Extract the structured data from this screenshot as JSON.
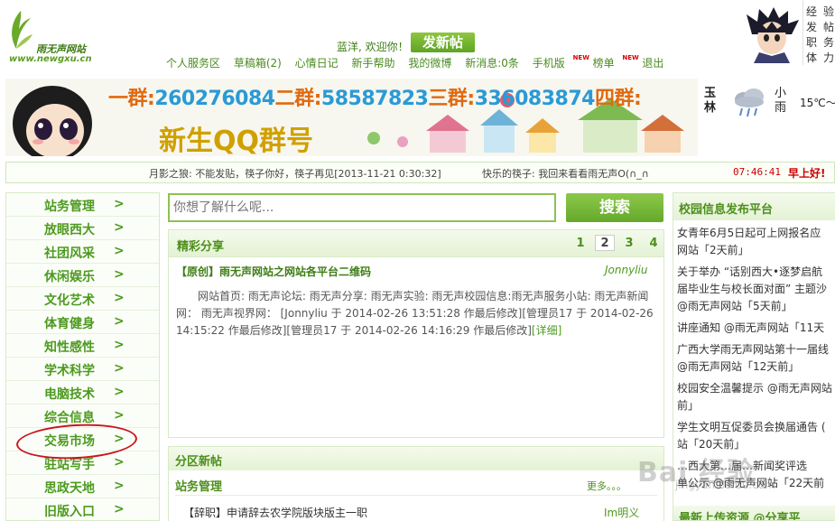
{
  "header": {
    "logo_name": "雨无声网站",
    "logo_url": "www.newgxu.cn",
    "welcome": "蓝洋, 欢迎你！",
    "post_button": "发新帖",
    "nav": [
      "个人服务区",
      "草稿箱(2)",
      "心情日记",
      "新手帮助",
      "我的微博",
      "新消息:0条",
      "手机版",
      "榜单",
      "退出"
    ],
    "new_badge": "NEW",
    "exp_chars": [
      "经",
      "验",
      "发",
      "帖",
      "职",
      "务",
      "体",
      "力"
    ]
  },
  "banner": {
    "qq_line": [
      "一群:",
      "260276084",
      "二群:",
      "58587823",
      "三群:",
      "336083874",
      "四群:"
    ],
    "big_text": "新生QQ群号"
  },
  "weather": {
    "city": "玉林",
    "condition": "小雨",
    "temp": "15℃～"
  },
  "ticker": {
    "msg1": "月影之狼: 不能发贴，筷子你好，筷子再见[2013-11-21 0:30:32]",
    "msg2": "快乐的筷子: 我回来看看雨无声O(∩_∩",
    "clock": "07:46:41",
    "greeting": "早上好!"
  },
  "left_menu": {
    "arrow": ">",
    "items": [
      "站务管理",
      "放眼西大",
      "社团风采",
      "休闲娱乐",
      "文化艺术",
      "体育健身",
      "知性感性",
      "学术科学",
      "电脑技术",
      "综合信息",
      "交易市场",
      "驻站写手",
      "思政天地",
      "旧版入口"
    ]
  },
  "search": {
    "placeholder": "你想了解什么呢...",
    "button": "搜索"
  },
  "featured": {
    "title": "精彩分享",
    "pages": [
      "1",
      "2",
      "3",
      "4"
    ],
    "active_page": "2",
    "post_title": "【原创】雨无声网站之网站各平台二维码",
    "post_author": "Jonnyliu",
    "post_body": "网站首页: 雨无声论坛: 雨无声分享: 雨无声实验: 雨无声校园信息:雨无声服务小站: 雨无声新闻网： 雨无声视界网： [Jonnyliu 于 2014-02-26 13:51:28 作最后修改][管理员17 于 2014-02-26 14:15:22 作最后修改][管理员17 于 2014-02-26 14:16:29 作最后修改]",
    "post_more": "[详细]"
  },
  "section_posts": {
    "title": "分区新帖",
    "sub_title": "站务管理",
    "more": "更多。。。",
    "item_text": "【辞职】申请辞去农学院版块版主一职",
    "item_author": "Im明义"
  },
  "campus_news": {
    "title": "校园信息发布平台",
    "lines": [
      "女青年6月5日起可上网报名应",
      "网站「2天前」",
      "关于举办 “话别西大•逐梦启航",
      "届毕业生与校长面对面” 主题沙",
      "@雨无声网站「5天前」",
      "讲座通知 @雨无声网站「11天",
      "广西大学雨无声网站第十一届线",
      "@雨无声网站「12天前」",
      "校园安全温馨提示 @雨无声网站",
      "前」",
      "学生文明互促委员会换届通告 (",
      "站「20天前」",
      "…西大第…届…新闻奖评选",
      "单公示 @雨无声网站「22天前"
    ],
    "bottom_title": "最新上传资源 @分享平"
  },
  "watermark": {
    "main": "Bai 经验",
    "sub": "jingyan.baidu.com"
  },
  "colors": {
    "brand_green": "#4d9a1f",
    "accent_red": "#cc0000",
    "circle_red": "#c8161e"
  }
}
